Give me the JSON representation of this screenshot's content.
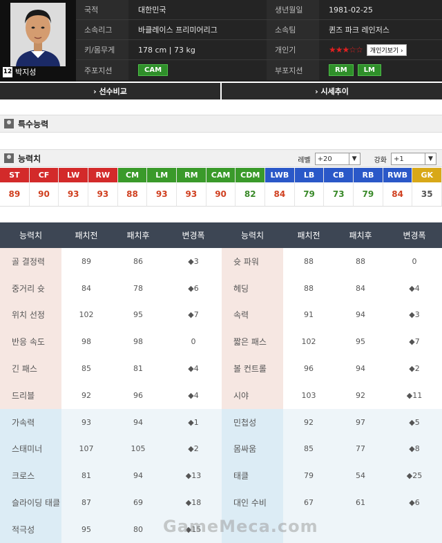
{
  "player": {
    "name": "박지성",
    "number": "12"
  },
  "info": [
    {
      "label1": "국적",
      "value1": "대한민국",
      "label2": "생년월일",
      "value2": "1981-02-25"
    },
    {
      "label1": "소속리그",
      "value1": "바클레이스 프리미어리그",
      "label2": "소속팀",
      "value2": "퀸즈 파크 레인저스"
    },
    {
      "label1": "키/몸무게",
      "value1": "178 cm | 73 kg",
      "label2": "개인기",
      "stars": "★★★☆☆",
      "skill_button": "개인기보기 ›"
    },
    {
      "label1": "주포지션",
      "main_positions": [
        "CAM"
      ],
      "label2": "부포지션",
      "sub_positions": [
        "RM",
        "LM"
      ]
    }
  ],
  "buttons": {
    "compare": "› 선수비교",
    "market": "› 시세추이"
  },
  "sections": {
    "special": "특수능력",
    "ability": "능력치"
  },
  "selectors": {
    "level_label": "레벨",
    "level_value": "+20",
    "enhance_label": "강화",
    "enhance_value": "+1"
  },
  "positions": [
    {
      "pos": "ST",
      "val": "89",
      "color": "#d32a2a",
      "valcolor": "#d04020"
    },
    {
      "pos": "CF",
      "val": "90",
      "color": "#d32a2a",
      "valcolor": "#d04020"
    },
    {
      "pos": "LW",
      "val": "93",
      "color": "#d32a2a",
      "valcolor": "#d04020"
    },
    {
      "pos": "RW",
      "val": "93",
      "color": "#d32a2a",
      "valcolor": "#d04020"
    },
    {
      "pos": "CM",
      "val": "88",
      "color": "#3a9a2a",
      "valcolor": "#d04020"
    },
    {
      "pos": "LM",
      "val": "93",
      "color": "#3a9a2a",
      "valcolor": "#d04020"
    },
    {
      "pos": "RM",
      "val": "93",
      "color": "#3a9a2a",
      "valcolor": "#d04020"
    },
    {
      "pos": "CAM",
      "val": "90",
      "color": "#3a9a2a",
      "valcolor": "#d04020"
    },
    {
      "pos": "CDM",
      "val": "82",
      "color": "#3a9a2a",
      "valcolor": "#3a8a2a"
    },
    {
      "pos": "LWB",
      "val": "84",
      "color": "#2a58c8",
      "valcolor": "#d04020"
    },
    {
      "pos": "LB",
      "val": "79",
      "color": "#2a58c8",
      "valcolor": "#3a8a2a"
    },
    {
      "pos": "CB",
      "val": "73",
      "color": "#2a58c8",
      "valcolor": "#3a8a2a"
    },
    {
      "pos": "RB",
      "val": "79",
      "color": "#2a58c8",
      "valcolor": "#3a8a2a"
    },
    {
      "pos": "RWB",
      "val": "84",
      "color": "#2a58c8",
      "valcolor": "#d04020"
    },
    {
      "pos": "GK",
      "val": "35",
      "color": "#d8a818",
      "valcolor": "#555555"
    }
  ],
  "stats_headers": [
    "능력치",
    "패치전",
    "패치후",
    "변경폭",
    "능력치",
    "패치전",
    "패치후",
    "변경폭"
  ],
  "stats": [
    {
      "group": "warm",
      "n1": "골 결정력",
      "b1": "89",
      "a1": "86",
      "c1": "◆3",
      "d1": "up",
      "n2": "슛 파워",
      "b2": "88",
      "a2": "88",
      "c2": "0",
      "d2": ""
    },
    {
      "group": "warm",
      "n1": "중거리 슛",
      "b1": "84",
      "a1": "78",
      "c1": "◆6",
      "d1": "up",
      "n2": "헤딩",
      "b2": "88",
      "a2": "84",
      "c2": "◆4",
      "d2": "up"
    },
    {
      "group": "warm",
      "n1": "위치 선정",
      "b1": "102",
      "a1": "95",
      "c1": "◆7",
      "d1": "up",
      "n2": "속력",
      "b2": "91",
      "a2": "94",
      "c2": "◆3",
      "d2": "dn"
    },
    {
      "group": "warm",
      "n1": "반응 속도",
      "b1": "98",
      "a1": "98",
      "c1": "0",
      "d1": "",
      "n2": "짧은 패스",
      "b2": "102",
      "a2": "95",
      "c2": "◆7",
      "d2": "up"
    },
    {
      "group": "warm",
      "n1": "긴 패스",
      "b1": "85",
      "a1": "81",
      "c1": "◆4",
      "d1": "up",
      "n2": "볼 컨트롤",
      "b2": "96",
      "a2": "94",
      "c2": "◆2",
      "d2": "up"
    },
    {
      "group": "warm",
      "n1": "드리블",
      "b1": "92",
      "a1": "96",
      "c1": "◆4",
      "d1": "dn",
      "n2": "시야",
      "b2": "103",
      "a2": "92",
      "c2": "◆11",
      "d2": "up"
    },
    {
      "group": "cool",
      "n1": "가속력",
      "b1": "93",
      "a1": "94",
      "c1": "◆1",
      "d1": "dn",
      "n2": "민첩성",
      "b2": "92",
      "a2": "97",
      "c2": "◆5",
      "d2": "dn"
    },
    {
      "group": "cool",
      "n1": "스태미너",
      "b1": "107",
      "a1": "105",
      "c1": "◆2",
      "d1": "up",
      "n2": "몸싸움",
      "b2": "85",
      "a2": "77",
      "c2": "◆8",
      "d2": "up"
    },
    {
      "group": "cool",
      "n1": "크로스",
      "b1": "81",
      "a1": "94",
      "c1": "◆13",
      "d1": "dn",
      "n2": "태클",
      "b2": "79",
      "a2": "54",
      "c2": "◆25",
      "d2": "up"
    },
    {
      "group": "cool",
      "n1": "슬라이딩 태클",
      "b1": "87",
      "a1": "69",
      "c1": "◆18",
      "d1": "up",
      "n2": "대인 수비",
      "b2": "67",
      "a2": "61",
      "c2": "◆6",
      "d2": "up"
    },
    {
      "group": "cool",
      "n1": "적극성",
      "b1": "95",
      "a1": "80",
      "c1": "◆15",
      "d1": "up",
      "n2": "",
      "b2": "",
      "a2": "",
      "c2": "",
      "d2": ""
    }
  ],
  "watermark": "GameMeca.com"
}
